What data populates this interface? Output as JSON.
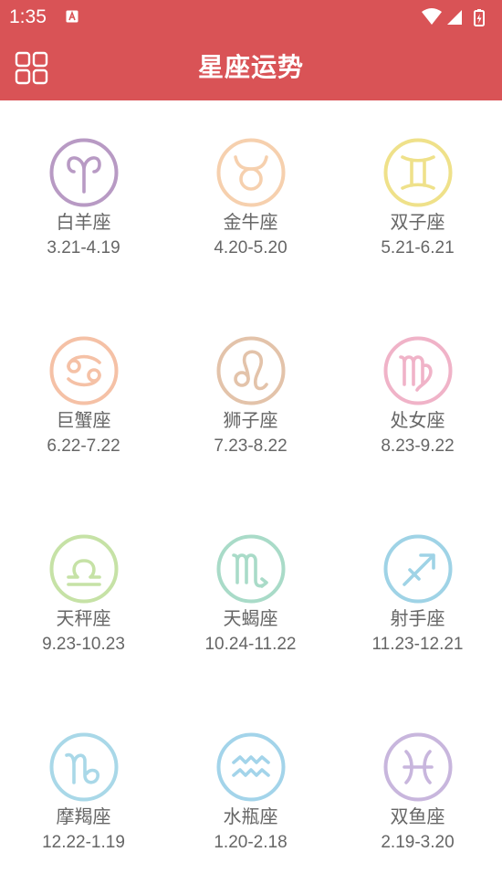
{
  "status_bar": {
    "time": "1:35",
    "notification_icon": "app-notification-icon",
    "icons": [
      "wifi-icon",
      "signal-icon",
      "battery-charging-icon"
    ]
  },
  "app_bar": {
    "title": "星座运势",
    "menu_icon": "grid-menu-icon",
    "background_color": "#d95356"
  },
  "signs": [
    {
      "name": "白羊座",
      "dates": "3.21-4.19",
      "icon": "aries-icon",
      "color": "#b89ac4"
    },
    {
      "name": "金牛座",
      "dates": "4.20-5.20",
      "icon": "taurus-icon",
      "color": "#f6d0ae"
    },
    {
      "name": "双子座",
      "dates": "5.21-6.21",
      "icon": "gemini-icon",
      "color": "#efe18a"
    },
    {
      "name": "巨蟹座",
      "dates": "6.22-7.22",
      "icon": "cancer-icon",
      "color": "#f5c1a6"
    },
    {
      "name": "狮子座",
      "dates": "7.23-8.22",
      "icon": "leo-icon",
      "color": "#e3c3aa"
    },
    {
      "name": "处女座",
      "dates": "8.23-9.22",
      "icon": "virgo-icon",
      "color": "#f0b3c8"
    },
    {
      "name": "天秤座",
      "dates": "9.23-10.23",
      "icon": "libra-icon",
      "color": "#c6e2a6"
    },
    {
      "name": "天蝎座",
      "dates": "10.24-11.22",
      "icon": "scorpio-icon",
      "color": "#a9dbc8"
    },
    {
      "name": "射手座",
      "dates": "11.23-12.21",
      "icon": "sagittarius-icon",
      "color": "#9fd3e6"
    },
    {
      "name": "摩羯座",
      "dates": "12.22-1.19",
      "icon": "capricorn-icon",
      "color": "#a9d8e8"
    },
    {
      "name": "水瓶座",
      "dates": "1.20-2.18",
      "icon": "aquarius-icon",
      "color": "#a3d4ea"
    },
    {
      "name": "双鱼座",
      "dates": "2.19-3.20",
      "icon": "pisces-icon",
      "color": "#c8b6dd"
    }
  ]
}
